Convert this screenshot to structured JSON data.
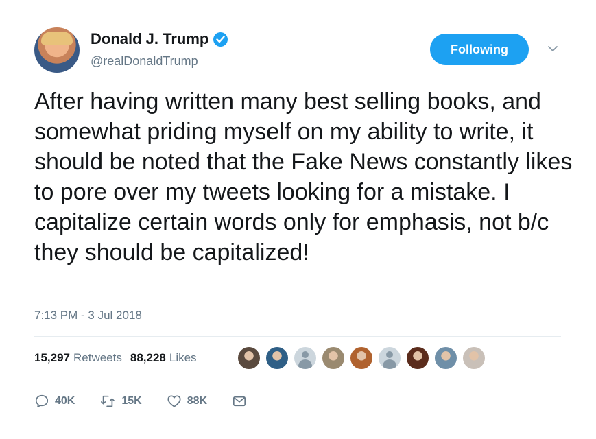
{
  "author": {
    "name": "Donald J. Trump",
    "handle": "@realDonaldTrump",
    "verified": true
  },
  "follow_button": {
    "label": "Following"
  },
  "menu_icon": "chevron-down-icon",
  "tweet": {
    "text": "After having written many best selling books, and somewhat priding myself on my ability to write, it should be noted that the Fake News constantly likes to pore over my tweets looking for a mistake. I capitalize certain words only for emphasis, not b/c they should be capitalized!",
    "timestamp": "7:13 PM - 3 Jul 2018"
  },
  "stats": {
    "retweets": {
      "count": "15,297",
      "label": "Retweets"
    },
    "likes": {
      "count": "88,228",
      "label": "Likes"
    }
  },
  "liker_avatars": [
    {
      "type": "photo",
      "color": "#5a4a3e"
    },
    {
      "type": "photo",
      "color": "#2f5f86"
    },
    {
      "type": "default",
      "color": "#ccd6dd"
    },
    {
      "type": "photo",
      "color": "#9a8a70"
    },
    {
      "type": "photo",
      "color": "#b0622e"
    },
    {
      "type": "default",
      "color": "#ccd6dd"
    },
    {
      "type": "photo",
      "color": "#5b2c1c"
    },
    {
      "type": "photo",
      "color": "#6f8fa8"
    },
    {
      "type": "photo",
      "color": "#c9c0b8"
    }
  ],
  "actions": {
    "reply": {
      "icon": "reply-icon",
      "count": "40K"
    },
    "retweet": {
      "icon": "retweet-icon",
      "count": "15K"
    },
    "like": {
      "icon": "heart-icon",
      "count": "88K"
    },
    "message": {
      "icon": "envelope-icon"
    }
  },
  "colors": {
    "accent": "#1da1f2",
    "muted_text": "#657786",
    "divider": "#e6ecf0"
  }
}
